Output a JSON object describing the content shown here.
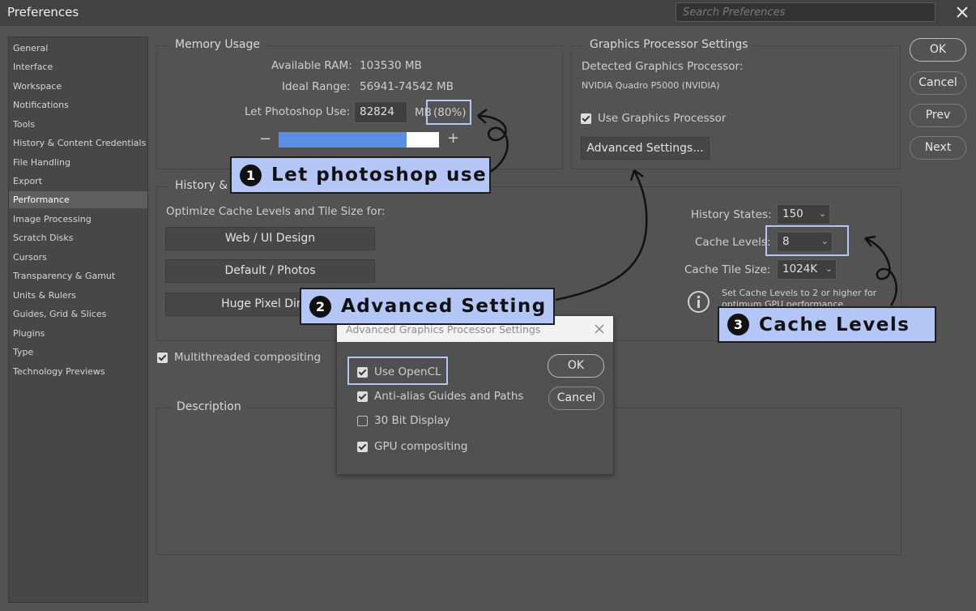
{
  "window": {
    "title": "Preferences",
    "search_placeholder": "Search Preferences"
  },
  "sidebar": {
    "items": [
      {
        "label": "General"
      },
      {
        "label": "Interface"
      },
      {
        "label": "Workspace"
      },
      {
        "label": "Notifications"
      },
      {
        "label": "Tools"
      },
      {
        "label": "History & Content Credentials"
      },
      {
        "label": "File Handling"
      },
      {
        "label": "Export"
      },
      {
        "label": "Performance",
        "active": true
      },
      {
        "label": "Image Processing"
      },
      {
        "label": "Scratch Disks"
      },
      {
        "label": "Cursors"
      },
      {
        "label": "Transparency & Gamut"
      },
      {
        "label": "Units & Rulers"
      },
      {
        "label": "Guides, Grid & Slices"
      },
      {
        "label": "Plugins"
      },
      {
        "label": "Type"
      },
      {
        "label": "Technology Previews"
      }
    ]
  },
  "memory": {
    "title": "Memory Usage",
    "available_label": "Available RAM:",
    "available_value": "103530 MB",
    "ideal_label": "Ideal Range:",
    "ideal_value": "56941-74542 MB",
    "use_label": "Let Photoshop Use:",
    "use_value": "82824",
    "unit": "MB",
    "percent": "(80%)",
    "slider_fraction": 0.8,
    "minus": "−",
    "plus": "+"
  },
  "gpu": {
    "title": "Graphics Processor Settings",
    "detected_label": "Detected Graphics Processor:",
    "detected_value": "NVIDIA Quadro P5000 (NVIDIA)",
    "use_gpu_label": "Use Graphics Processor",
    "use_gpu_checked": true,
    "advanced_button": "Advanced Settings..."
  },
  "history_cache": {
    "title": "History & C",
    "optimize_label": "Optimize Cache Levels and Tile Size for:",
    "buttons": [
      "Web / UI Design",
      "Default / Photos",
      "Huge Pixel Dimer"
    ],
    "history_states_label": "History States:",
    "history_states_value": "150",
    "cache_levels_label": "Cache Levels:",
    "cache_levels_value": "8",
    "tile_size_label": "Cache Tile Size:",
    "tile_size_value": "1024K",
    "info_text_1": "Set Cache Levels to 2 or higher for",
    "info_text_2": "optimum GPU performance."
  },
  "multithreaded": {
    "label": "Multithreaded compositing",
    "checked": true
  },
  "description": {
    "title": "Description"
  },
  "actions": {
    "ok": "OK",
    "cancel": "Cancel",
    "prev": "Prev",
    "next": "Next"
  },
  "advanced_dialog": {
    "title": "Advanced Graphics Processor Settings",
    "options": [
      {
        "label": "Use OpenCL",
        "checked": true
      },
      {
        "label": "Anti-alias Guides and Paths",
        "checked": true
      },
      {
        "label": "30 Bit Display",
        "checked": false
      },
      {
        "label": "GPU compositing",
        "checked": true
      }
    ],
    "ok": "OK",
    "cancel": "Cancel"
  },
  "annotations": [
    {
      "number": "1",
      "text": "Let photoshop use"
    },
    {
      "number": "2",
      "text": "Advanced Setting"
    },
    {
      "number": "3",
      "text": "Cache Levels"
    }
  ],
  "colors": {
    "accent_fill": "#5b8fe4",
    "callout_bg": "#b3c6f5",
    "dialog_bg": "#535353"
  }
}
